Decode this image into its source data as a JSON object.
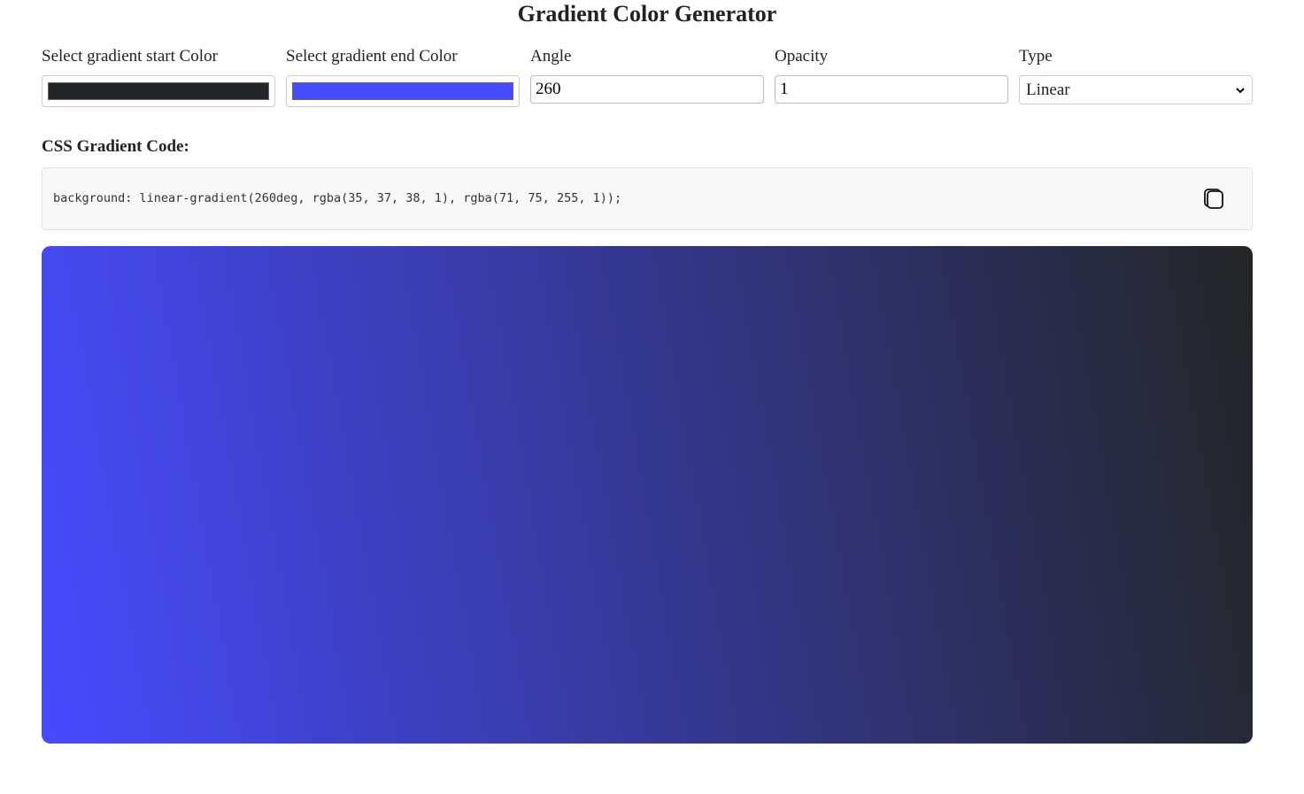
{
  "title": "Gradient Color Generator",
  "controls": {
    "start_label": "Select gradient start Color",
    "start_color": "#232526",
    "end_label": "Select gradient end Color",
    "end_color": "#474bff",
    "angle_label": "Angle",
    "angle_value": "260",
    "opacity_label": "Opacity",
    "opacity_value": "1",
    "type_label": "Type",
    "type_value": "Linear"
  },
  "code": {
    "heading": "CSS Gradient Code:",
    "text": "background: linear-gradient(260deg, rgba(35, 37, 38, 1), rgba(71, 75, 255, 1));",
    "copy_icon": "copy-icon"
  },
  "preview": {
    "gradient": "linear-gradient(260deg, rgba(35, 37, 38, 1), rgba(71, 75, 255, 1))"
  }
}
